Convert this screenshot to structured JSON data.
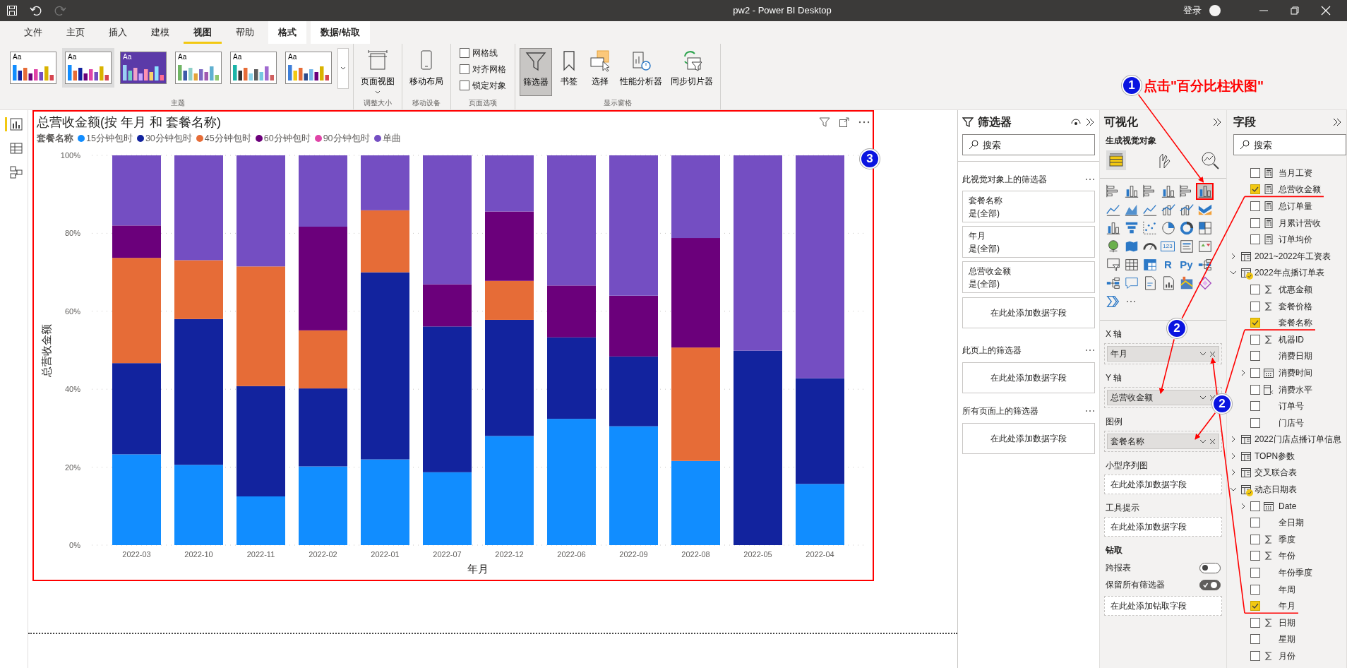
{
  "window": {
    "title": "pw2 - Power BI Desktop",
    "sign_in": "登录"
  },
  "quick_access": [
    {
      "disabled": false
    },
    {
      "disabled": false
    },
    {
      "disabled": true
    }
  ],
  "menu_tabs": [
    {
      "label": "文件",
      "kind": "normal",
      "selected": false
    },
    {
      "label": "主页",
      "kind": "normal",
      "selected": false
    },
    {
      "label": "插入",
      "kind": "normal",
      "selected": false
    },
    {
      "label": "建模",
      "kind": "normal",
      "selected": false
    },
    {
      "label": "视图",
      "kind": "normal",
      "selected": true
    },
    {
      "label": "帮助",
      "kind": "normal",
      "selected": false
    },
    {
      "label": "格式",
      "kind": "contextual",
      "selected": false
    },
    {
      "label": "数据/钻取",
      "kind": "contextual",
      "selected": false
    }
  ],
  "ribbon": {
    "groups": [
      {
        "kind": "gallery",
        "label": "主题",
        "themes": [
          {
            "label": "Aa",
            "selected": false
          },
          {
            "label": "Aa",
            "selected": true
          },
          {
            "label": "Aa",
            "selected": false
          },
          {
            "label": "Aa",
            "selected": false
          },
          {
            "label": "Aa",
            "selected": false
          },
          {
            "label": "Aa",
            "selected": false
          }
        ]
      },
      {
        "kind": "buttons",
        "label": "调整大小",
        "buttons": [
          {
            "label": "页面视图",
            "dropdown": true,
            "selected": false
          }
        ]
      },
      {
        "kind": "buttons",
        "label": "移动设备",
        "buttons": [
          {
            "label": "移动布局",
            "dropdown": false,
            "selected": false
          }
        ]
      },
      {
        "kind": "checkboxes",
        "label": "页面选项",
        "checkboxes": [
          {
            "label": "网格线",
            "checked": false
          },
          {
            "label": "对齐网格",
            "checked": false
          },
          {
            "label": "锁定对象",
            "checked": false
          }
        ]
      },
      {
        "kind": "buttons",
        "label": "显示窗格",
        "buttons": [
          {
            "label": "筛选器",
            "dropdown": false,
            "selected": true
          },
          {
            "label": "书签",
            "dropdown": false,
            "selected": false
          },
          {
            "label": "选择",
            "dropdown": false,
            "selected": false
          },
          {
            "label": "性能分析器",
            "dropdown": false,
            "selected": false
          },
          {
            "label": "同步切片器",
            "dropdown": false,
            "selected": false
          }
        ]
      }
    ]
  },
  "left_nav": [
    {
      "selected": true
    },
    {
      "selected": false
    },
    {
      "selected": false
    }
  ],
  "visual": {
    "title": "总营收金额(按 年月 和 套餐名称)",
    "legend_title": "套餐名称",
    "chart_data": {
      "type": "bar",
      "stacked": true,
      "grid": true,
      "xlabel": "年月",
      "ylabel": "总营收金额",
      "categories": [
        "2022-03",
        "2022-10",
        "2022-11",
        "2022-02",
        "2022-01",
        "2022-07",
        "2022-12",
        "2022-06",
        "2022-09",
        "2022-08",
        "2022-05",
        "2022-04"
      ],
      "ylim": [
        0,
        100
      ],
      "yticks": [
        {
          "value": 0,
          "label": "0%"
        },
        {
          "value": 20,
          "label": "20%"
        },
        {
          "value": 40,
          "label": "40%"
        },
        {
          "value": 60,
          "label": "60%"
        },
        {
          "value": 80,
          "label": "80%"
        },
        {
          "value": 100,
          "label": "100%"
        }
      ],
      "series": [
        {
          "name": "15分钟包时",
          "color": "#118dff",
          "values": [
            23.3,
            20.6,
            12.5,
            20.2,
            22.0,
            18.7,
            28.0,
            32.4,
            30.5,
            21.6,
            null,
            15.7
          ]
        },
        {
          "name": "30分钟包时",
          "color": "#12239e",
          "values": [
            23.4,
            37.4,
            28.3,
            20.0,
            48.0,
            37.4,
            29.8,
            20.9,
            17.9,
            null,
            49.9,
            27.1
          ]
        },
        {
          "name": "45分钟包时",
          "color": "#e66c37",
          "values": [
            27.0,
            15.1,
            30.7,
            14.9,
            15.9,
            null,
            10.0,
            null,
            null,
            29.1,
            null,
            null
          ]
        },
        {
          "name": "60分钟包时",
          "color": "#6b007b",
          "values": [
            8.3,
            null,
            null,
            26.6,
            null,
            10.8,
            17.8,
            13.3,
            15.6,
            28.1,
            null,
            null
          ]
        },
        {
          "name": "90分钟包时",
          "color": "#e044a7",
          "values": [
            null,
            null,
            null,
            null,
            null,
            null,
            null,
            null,
            null,
            null,
            null,
            null
          ]
        },
        {
          "name": "单曲",
          "color": "#744ec2",
          "values": [
            18.0,
            26.9,
            28.5,
            18.3,
            14.1,
            33.1,
            14.4,
            33.4,
            36.0,
            21.2,
            50.1,
            57.2
          ]
        }
      ]
    }
  },
  "filters_pane": {
    "title": "筛选器",
    "search_placeholder": "搜索",
    "sections": [
      {
        "title": "此视觉对象上的筛选器",
        "cards": [
          {
            "field": "套餐名称",
            "value": "是(全部)"
          },
          {
            "field": "年月",
            "value": "是(全部)"
          },
          {
            "field": "总营收金额",
            "value": "是(全部)"
          }
        ],
        "drop_zone": "在此处添加数据字段"
      },
      {
        "title": "此页上的筛选器",
        "drop_zone": "在此处添加数据字段"
      },
      {
        "title": "所有页面上的筛选器",
        "drop_zone": "在此处添加数据字段"
      }
    ]
  },
  "viz_pane": {
    "title": "可视化",
    "subtitle": "生成视觉对象",
    "modes": [
      {
        "selected": true
      },
      {
        "selected": false
      },
      {
        "selected": false
      }
    ],
    "visual_types": [
      {
        "selected": false
      },
      {
        "selected": false
      },
      {
        "selected": false
      },
      {
        "selected": false
      },
      {
        "selected": false
      },
      {
        "selected": true
      },
      {
        "selected": false
      },
      {
        "selected": false
      },
      {
        "selected": false
      },
      {
        "selected": false
      },
      {
        "selected": false
      },
      {
        "selected": false
      },
      {
        "selected": false
      },
      {
        "selected": false
      },
      {
        "selected": false
      },
      {
        "selected": false
      },
      {
        "selected": false
      },
      {
        "selected": false
      },
      {
        "selected": false
      },
      {
        "selected": false
      },
      {
        "selected": false
      },
      {
        "selected": false,
        "glyph": "123"
      },
      {
        "selected": false
      },
      {
        "selected": false
      },
      {
        "selected": false
      },
      {
        "selected": false
      },
      {
        "selected": false
      },
      {
        "selected": false,
        "glyph": "R"
      },
      {
        "selected": false,
        "glyph": "Py"
      },
      {
        "selected": false
      },
      {
        "selected": false
      },
      {
        "selected": false
      },
      {
        "selected": false
      },
      {
        "selected": false
      },
      {
        "selected": false
      },
      {
        "selected": false
      },
      {
        "selected": false
      }
    ],
    "wells": [
      {
        "label": "X 轴",
        "field": "年月"
      },
      {
        "label": "Y 轴",
        "field": "总营收金额"
      },
      {
        "label": "图例",
        "field": "套餐名称"
      },
      {
        "label": "小型序列图",
        "placeholder": "在此处添加数据字段"
      },
      {
        "label": "工具提示",
        "placeholder": "在此处添加数据字段"
      }
    ],
    "drillthrough": {
      "title": "钻取",
      "toggles": [
        {
          "label": "跨报表",
          "on": false
        },
        {
          "label": "保留所有筛选器",
          "on": true
        }
      ],
      "drop_zone": "在此处添加钻取字段"
    }
  },
  "fields_pane": {
    "title": "字段",
    "search_placeholder": "搜索",
    "items": [
      {
        "kind": "continued",
        "children": [
          {
            "label": "当月工资",
            "kind": "measure",
            "checked": false
          },
          {
            "label": "总营收金额",
            "kind": "measure",
            "checked": true
          },
          {
            "label": "总订单量",
            "kind": "measure",
            "checked": false
          },
          {
            "label": "月累计营收",
            "kind": "measure",
            "checked": false
          },
          {
            "label": "订单均价",
            "kind": "measure",
            "checked": false
          }
        ]
      },
      {
        "kind": "table",
        "label": "2021~2022年工资表",
        "expanded": false,
        "has_selection": false
      },
      {
        "kind": "table",
        "label": "2022年点播订单表",
        "expanded": true,
        "has_selection": true,
        "children": [
          {
            "label": "优惠金额",
            "kind": "sum",
            "checked": false
          },
          {
            "label": "套餐价格",
            "kind": "sum",
            "checked": false
          },
          {
            "label": "套餐名称",
            "kind": "text",
            "checked": true
          },
          {
            "label": "机器ID",
            "kind": "sum",
            "checked": false
          },
          {
            "label": "消费日期",
            "kind": "text",
            "checked": false
          },
          {
            "label": "消费时间",
            "kind": "hierarchy",
            "expanded": false,
            "checked": false
          },
          {
            "label": "消费水平",
            "kind": "calc",
            "checked": false
          },
          {
            "label": "订单号",
            "kind": "text",
            "checked": false
          },
          {
            "label": "门店号",
            "kind": "text",
            "checked": false
          }
        ]
      },
      {
        "kind": "table",
        "label": "2022门店点播订单信息",
        "expanded": false,
        "has_selection": false
      },
      {
        "kind": "table",
        "label": "TOPN参数",
        "expanded": false,
        "has_selection": false
      },
      {
        "kind": "table",
        "label": "交叉联合表",
        "expanded": false,
        "has_selection": false
      },
      {
        "kind": "table",
        "label": "动态日期表",
        "expanded": true,
        "has_selection": true,
        "children": [
          {
            "label": "Date",
            "kind": "hierarchy",
            "expanded": false,
            "checked": false
          },
          {
            "label": "全日期",
            "kind": "text",
            "checked": false
          },
          {
            "label": "季度",
            "kind": "sum",
            "checked": false
          },
          {
            "label": "年份",
            "kind": "sum",
            "checked": false
          },
          {
            "label": "年份季度",
            "kind": "text",
            "checked": false
          },
          {
            "label": "年周",
            "kind": "text",
            "checked": false
          },
          {
            "label": "年月",
            "kind": "text",
            "checked": true
          },
          {
            "label": "日期",
            "kind": "sum",
            "checked": false
          },
          {
            "label": "星期",
            "kind": "text",
            "checked": false
          },
          {
            "label": "月份",
            "kind": "sum",
            "checked": false
          }
        ]
      }
    ]
  },
  "annotations": [
    {
      "number": "1",
      "text": "点击\"百分比柱状图\""
    },
    {
      "number": "2"
    },
    {
      "number": "2"
    },
    {
      "number": "3"
    }
  ]
}
